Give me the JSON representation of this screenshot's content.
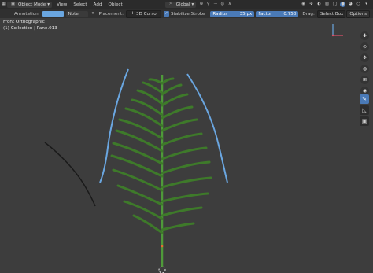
{
  "header": {
    "mode_label": "Object Mode",
    "menus": [
      "View",
      "Select",
      "Add",
      "Object"
    ],
    "transform_label": "Global"
  },
  "toolsettings": {
    "annotation_label": "Annotation:",
    "note_label": "Note",
    "placement_label": "Placement:",
    "placement_value": "3D Cursor",
    "stabilize_label": "Stabilize Stroke",
    "radius_label": "Radius",
    "radius_value": "35 px",
    "factor_label": "Factor",
    "factor_value": "0.750",
    "drag_label": "Drag:",
    "drag_value": "Select Box",
    "options_label": "Options"
  },
  "viewport": {
    "view_name": "Front Orthographic",
    "collection_label": "(1) Collection | Pane.013"
  },
  "colors": {
    "annotation_blue": "#6aa6e0",
    "leaf_green": "#3e7a2a",
    "stem_green": "#4f9a3a",
    "black_stroke": "#1a1a1a"
  }
}
